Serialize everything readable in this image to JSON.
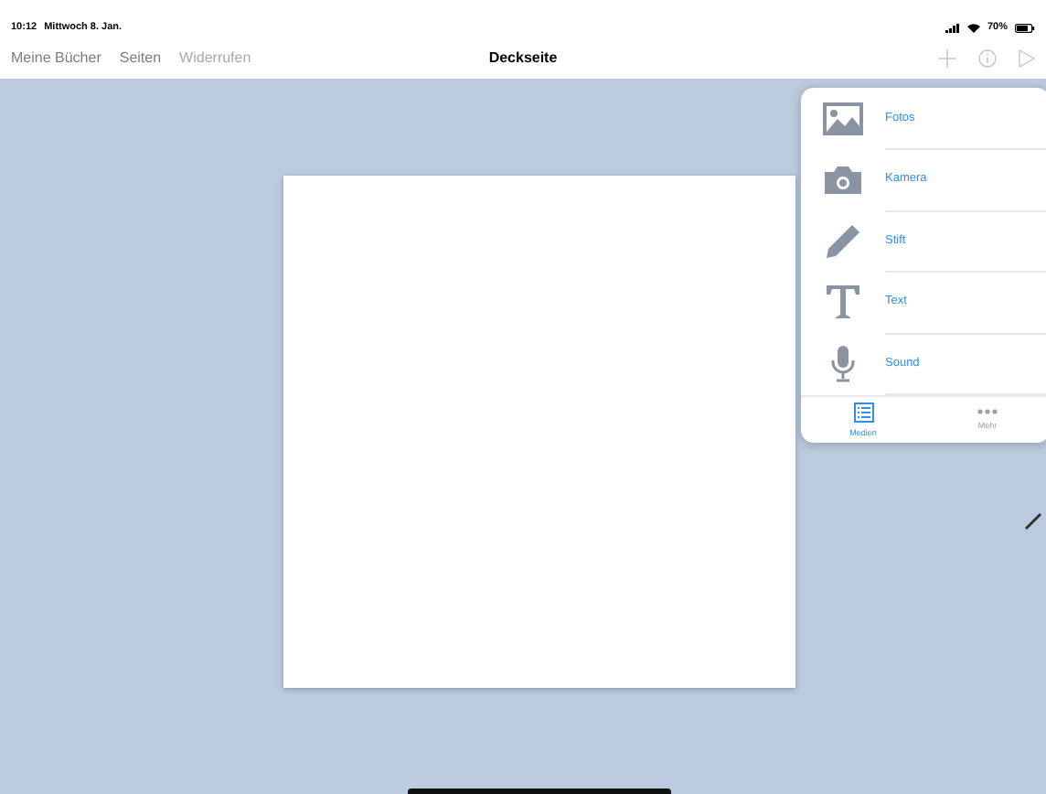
{
  "status_bar": {
    "time": "10:12",
    "date": "Mittwoch 8. Jan.",
    "battery": "70%"
  },
  "nav_bar": {
    "buttons": [
      {
        "label": "Meine Bücher",
        "disabled": false
      },
      {
        "label": "Seiten",
        "disabled": false
      },
      {
        "label": "Widerrufen",
        "disabled": true
      }
    ],
    "title": "Deckseite"
  },
  "popover": {
    "items": [
      {
        "kind": "photo",
        "label": "Fotos"
      },
      {
        "kind": "camera",
        "label": "Kamera"
      },
      {
        "kind": "pen",
        "label": "Stift"
      },
      {
        "kind": "text",
        "label": "Text"
      },
      {
        "kind": "mic",
        "label": "Sound"
      }
    ],
    "tabs": [
      {
        "kind": "list",
        "label": "Medien",
        "selected": true
      },
      {
        "kind": "more",
        "label": "Mehr",
        "selected": false
      }
    ]
  }
}
